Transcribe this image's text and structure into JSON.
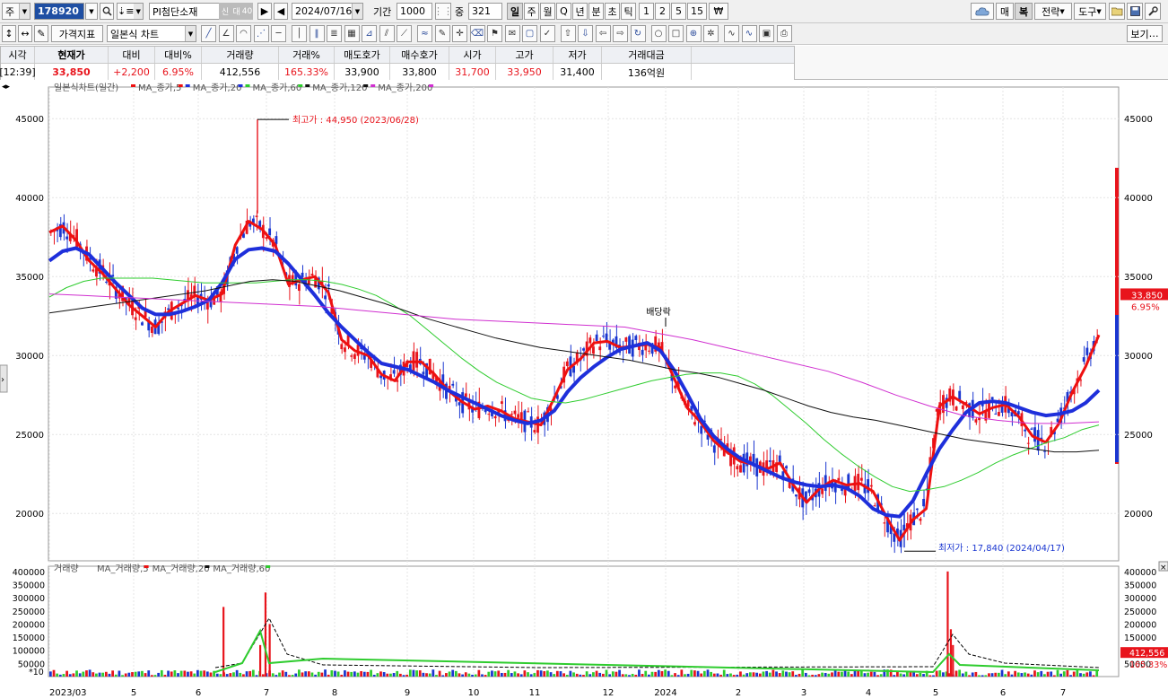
{
  "toolbar1": {
    "market_label": "주",
    "code": "178920",
    "name": "PI첨단소재",
    "badges": [
      "신",
      "대",
      "40"
    ],
    "date": "2024/07/16",
    "period_label": "기간",
    "period_value": "1000",
    "count_label": "중",
    "count_value": "321",
    "timeframes": [
      "일",
      "주",
      "월",
      "Q",
      "년",
      "분",
      "초",
      "틱",
      "1",
      "2",
      "5",
      "15",
      "₩"
    ],
    "active_timeframe": "일",
    "right_buttons": [
      "매",
      "복",
      "전략",
      "도구"
    ]
  },
  "toolbar2": {
    "price_indicator": "가격지표",
    "chart_type": "일본식 차트",
    "view_button": "보기"
  },
  "quote": {
    "headers": [
      "시각",
      "현재가",
      "대비",
      "대비%",
      "거래량",
      "거래%",
      "매도호가",
      "매수호가",
      "시가",
      "고가",
      "저가",
      "거래대금"
    ],
    "values": [
      "[12:39]",
      "33,850",
      "+2,200",
      "6.95%",
      "412,556",
      "165.33%",
      "33,900",
      "33,800",
      "31,700",
      "33,950",
      "31,400",
      "136억원"
    ]
  },
  "colors": {
    "up": "#e8141c",
    "down": "#1a36d0",
    "ma5": "#ee1010",
    "ma20": "#1e2fdb",
    "ma60": "#2ecc2e",
    "ma120": "#111111",
    "ma200": "#d02fd0"
  },
  "chart_data": {
    "type": "line",
    "title": "일본식차트(일간)",
    "legend": [
      {
        "name": "MA_종가,5",
        "color": "#ee1010"
      },
      {
        "name": "MA_종가,20",
        "color": "#1e2fdb"
      },
      {
        "name": "MA_종가,60",
        "color": "#2ecc2e"
      },
      {
        "name": "MA_종가,120",
        "color": "#111111"
      },
      {
        "name": "MA_종가,200",
        "color": "#d02fd0"
      }
    ],
    "y_ticks": [
      45000,
      40000,
      35000,
      30000,
      25000,
      20000
    ],
    "ylim": [
      17000,
      47000
    ],
    "x_labels": [
      "2023/03",
      "5",
      "6",
      "7",
      "8",
      "9",
      "10",
      "11",
      "12",
      "2024",
      "2",
      "3",
      "4",
      "5",
      "6",
      "7"
    ],
    "annotations": {
      "high": "최고가 : 44,950 (2023/06/28)",
      "low": "최저가 : 17,840 (2024/04/17)",
      "dividend": "배당락"
    },
    "last_price": "33,850",
    "last_change": "6.95%",
    "series": [
      {
        "name": "MA_종가,5",
        "values": [
          37800,
          38200,
          37300,
          36000,
          35200,
          34200,
          33200,
          32500,
          31800,
          32800,
          33300,
          33800,
          33500,
          33900,
          37000,
          38500,
          38000,
          37000,
          34500,
          34800,
          35000,
          34000,
          31000,
          30300,
          30000,
          28800,
          28400,
          29600,
          29600,
          28800,
          27800,
          27100,
          26600,
          26800,
          26500,
          26000,
          25800,
          25600,
          27300,
          29100,
          29800,
          30800,
          30900,
          30500,
          30600,
          30700,
          30500,
          28600,
          26700,
          25800,
          24600,
          23900,
          23300,
          23100,
          22800,
          23200,
          21800,
          20700,
          21600,
          22100,
          21800,
          21900,
          21400,
          19800,
          18300,
          19600,
          20300,
          26800,
          27400,
          26900,
          26300,
          26700,
          26900,
          26100,
          24900,
          24500,
          25700,
          27700,
          29300,
          31300
        ]
      },
      {
        "name": "MA_종가,20",
        "values": [
          36000,
          36600,
          36800,
          36400,
          35500,
          34600,
          33800,
          33000,
          32600,
          32600,
          32800,
          33100,
          33500,
          34600,
          36100,
          36700,
          36800,
          36600,
          35800,
          34800,
          33800,
          32700,
          31800,
          31000,
          30200,
          29500,
          29300,
          29100,
          28700,
          28300,
          27800,
          27400,
          27000,
          26600,
          26200,
          25900,
          25700,
          25900,
          26500,
          27700,
          28600,
          29300,
          29900,
          30400,
          30600,
          30800,
          30300,
          29100,
          27600,
          26000,
          24900,
          24100,
          23500,
          23100,
          22700,
          22300,
          22000,
          21800,
          21700,
          21800,
          21600,
          21100,
          20300,
          19900,
          19800,
          20800,
          22500,
          24100,
          25300,
          26400,
          27000,
          27100,
          27000,
          26700,
          26400,
          26200,
          26300,
          26500,
          27000,
          27800
        ]
      },
      {
        "name": "MA_종가,60",
        "values": [
          33700,
          34300,
          34700,
          34900,
          34900,
          34900,
          34900,
          34800,
          34700,
          34600,
          34600,
          34600,
          34600,
          34700,
          34800,
          34800,
          34700,
          34500,
          34200,
          33800,
          33200,
          32500,
          31600,
          30700,
          29800,
          29000,
          28300,
          27800,
          27300,
          27100,
          27000,
          27200,
          27500,
          27800,
          28100,
          28400,
          28600,
          28800,
          28900,
          28900,
          28700,
          28200,
          27500,
          26600,
          25700,
          24700,
          23800,
          23000,
          22300,
          21700,
          21400,
          21500,
          21700,
          22100,
          22600,
          23200,
          23700,
          24100,
          24500,
          24800,
          25300,
          25600
        ]
      },
      {
        "name": "MA_종가,120",
        "values": [
          32700,
          32900,
          33100,
          33300,
          33500,
          33700,
          33900,
          34100,
          34400,
          34700,
          34800,
          34700,
          34400,
          34100,
          33700,
          33300,
          32800,
          32300,
          31900,
          31500,
          31100,
          30800,
          30500,
          30300,
          30100,
          29900,
          29700,
          29400,
          29100,
          28900,
          28600,
          28200,
          27800,
          27300,
          26800,
          26400,
          26100,
          25900,
          25600,
          25300,
          25000,
          24700,
          24500,
          24300,
          24100,
          23900,
          23900,
          24000
        ]
      },
      {
        "name": "MA_종가,200",
        "values": [
          33900,
          33800,
          33700,
          33600,
          33500,
          33400,
          33300,
          33200,
          33100,
          32900,
          32700,
          32500,
          32300,
          32200,
          32100,
          32000,
          31900,
          31800,
          31400,
          31000,
          30500,
          30000,
          29500,
          29000,
          28300,
          27500,
          26800,
          26200,
          25900,
          25700,
          25700,
          25800
        ]
      }
    ]
  },
  "volume_chart": {
    "title": "거래량",
    "legend": [
      {
        "name": "MA_거래량,5",
        "color": "#ee1010"
      },
      {
        "name": "MA_거래량,20",
        "color": "#111111"
      },
      {
        "name": "MA_거래량,60",
        "color": "#2ecc2e"
      }
    ],
    "y_ticks": [
      400000,
      350000,
      300000,
      250000,
      200000,
      150000,
      100000,
      50000
    ],
    "unit": "*10",
    "last_volume": "412,556",
    "last_percent": "165.33%",
    "spikes": [
      {
        "x": 0.165,
        "v": 265000
      },
      {
        "x": 0.205,
        "v": 320000
      },
      {
        "x": 0.209,
        "v": 200000
      },
      {
        "x": 0.2,
        "v": 120000
      },
      {
        "x": 0.855,
        "v": 400000
      },
      {
        "x": 0.858,
        "v": 180000
      },
      {
        "x": 0.86,
        "v": 120000
      }
    ]
  }
}
